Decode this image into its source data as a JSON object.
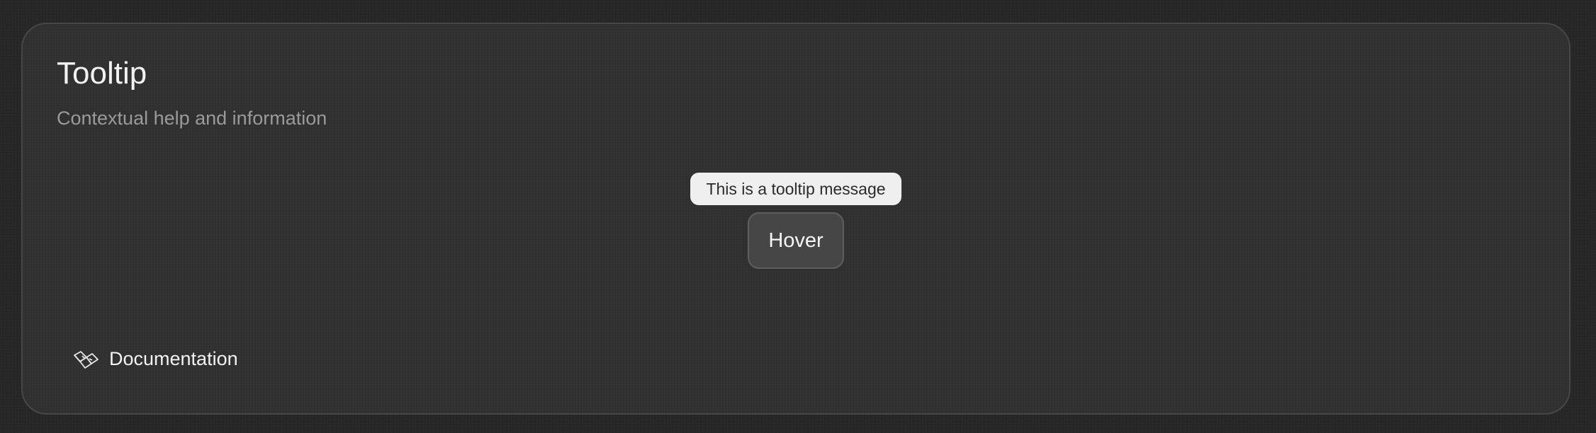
{
  "card": {
    "title": "Tooltip",
    "subtitle": "Contextual help and information"
  },
  "demo": {
    "tooltip_text": "This is a tooltip message",
    "button_label": "Hover"
  },
  "footer": {
    "link_label": "Documentation",
    "link_icon": "book-icon"
  }
}
